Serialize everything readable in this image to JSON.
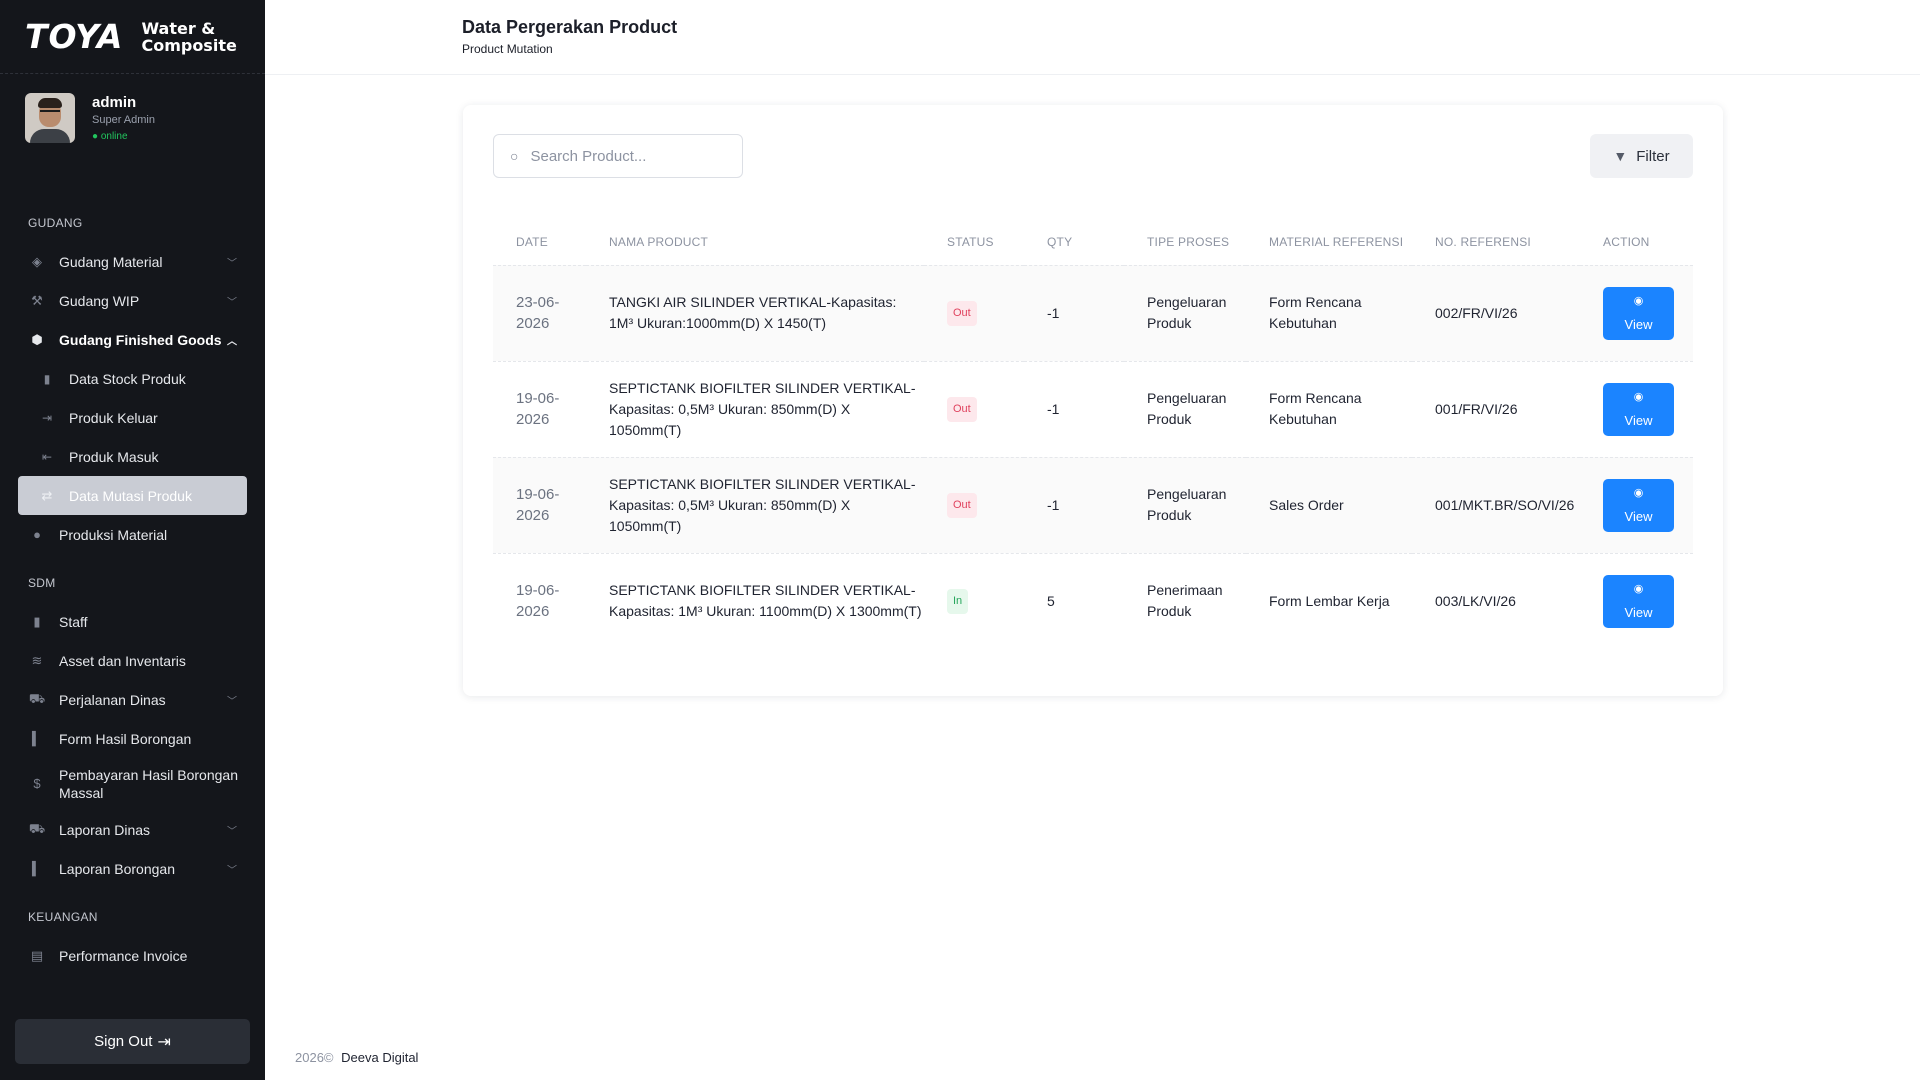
{
  "brand": {
    "name": "TOYA",
    "tagline_line1": "Water &",
    "tagline_line2": "Composite"
  },
  "profile": {
    "name": "admin",
    "role": "Super Admin",
    "status": "● online"
  },
  "sidebar": {
    "gudang": {
      "title": "GUDANG",
      "items": [
        {
          "label": "Gudang Material",
          "icon": "cube-stack-icon"
        },
        {
          "label": "Gudang WIP",
          "icon": "wrench-icon"
        },
        {
          "label": "Gudang Finished Goods",
          "icon": "box-icon"
        }
      ],
      "sub_items": [
        {
          "label": "Data Stock Produk",
          "icon": "document-icon"
        },
        {
          "label": "Produk Keluar",
          "icon": "arrow-out-icon"
        },
        {
          "label": "Produk Masuk",
          "icon": "arrow-in-icon"
        },
        {
          "label": "Data Mutasi Produk",
          "icon": "swap-icon"
        }
      ],
      "extra": {
        "label": "Produksi Material",
        "icon": "circle-icon"
      }
    },
    "sdm": {
      "title": "SDM",
      "items": [
        {
          "label": "Staff",
          "icon": "person-icon"
        },
        {
          "label": "Asset dan Inventaris",
          "icon": "layers-icon"
        },
        {
          "label": "Perjalanan Dinas",
          "icon": "car-icon"
        },
        {
          "label": "Form Hasil Borongan",
          "icon": "bar-icon"
        },
        {
          "label": "Pembayaran Hasil Borongan Massal",
          "icon": "dollar-icon"
        },
        {
          "label": "Laporan Dinas",
          "icon": "car-icon"
        },
        {
          "label": "Laporan Borongan",
          "icon": "bar-icon"
        }
      ]
    },
    "keuangan": {
      "title": "KEUANGAN",
      "items": [
        {
          "label": "Performance Invoice",
          "icon": "invoice-icon"
        }
      ]
    },
    "sign_out": "Sign Out"
  },
  "header": {
    "title": "Data Pergerakan Product",
    "subtitle": "Product Mutation"
  },
  "search": {
    "placeholder": "Search Product..."
  },
  "filter": {
    "label": "Filter"
  },
  "table": {
    "columns": [
      "DATE",
      "NAMA PRODUCT",
      "STATUS",
      "QTY",
      "TIPE PROSES",
      "MATERIAL REFERENSI",
      "NO. REFERENSI",
      "ACTION"
    ],
    "rows": [
      {
        "date": "23-06-2026",
        "product": "TANGKI AIR SILINDER VERTIKAL-Kapasitas: 1M³ Ukuran:1000mm(D) X 1450(T)",
        "status": "Out",
        "qty": "-1",
        "tipe": "Pengeluaran Produk",
        "material": "Form Rencana Kebutuhan",
        "no_ref": "002/FR/VI/26",
        "action": "View"
      },
      {
        "date": "19-06-2026",
        "product": "SEPTICTANK BIOFILTER SILINDER VERTIKAL-Kapasitas: 0,5M³ Ukuran: 850mm(D) X 1050mm(T)",
        "status": "Out",
        "qty": "-1",
        "tipe": "Pengeluaran Produk",
        "material": "Form Rencana Kebutuhan",
        "no_ref": "001/FR/VI/26",
        "action": "View"
      },
      {
        "date": "19-06-2026",
        "product": "SEPTICTANK BIOFILTER SILINDER VERTIKAL-Kapasitas: 0,5M³ Ukuran: 850mm(D) X 1050mm(T)",
        "status": "Out",
        "qty": "-1",
        "tipe": "Pengeluaran Produk",
        "material": "Sales Order",
        "no_ref": "001/MKT.BR/SO/VI/26",
        "action": "View"
      },
      {
        "date": "19-06-2026",
        "product": "SEPTICTANK BIOFILTER SILINDER VERTIKAL-Kapasitas: 1M³ Ukuran: 1100mm(D) X 1300mm(T)",
        "status": "In",
        "qty": "5",
        "tipe": "Penerimaan Produk",
        "material": "Form Lembar Kerja",
        "no_ref": "003/LK/VI/26",
        "action": "View"
      }
    ]
  },
  "footer": {
    "year": "2026©",
    "company": "Deeva Digital"
  },
  "colors": {
    "sidebar_bg": "#14161b",
    "accent": "#1b84ff",
    "out_badge": "#e0425e",
    "in_badge": "#26a65b",
    "selected_item": "#c9ccd4"
  }
}
